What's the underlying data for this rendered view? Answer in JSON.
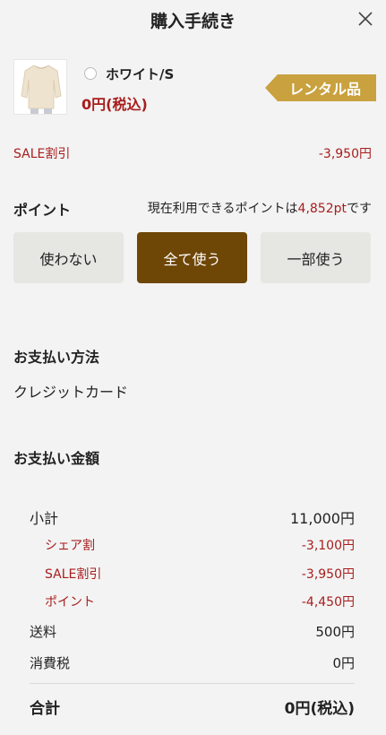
{
  "header": {
    "title": "購入手続き"
  },
  "product": {
    "variant": "ホワイト/S",
    "price": "0円(税込)",
    "badge": "レンタル品"
  },
  "sale": {
    "label": "SALE割引",
    "amount": "-3,950円"
  },
  "points": {
    "title": "ポイント",
    "info_prefix": "現在利用できるポイントは",
    "available": "4,852pt",
    "info_suffix": "です",
    "options": [
      "使わない",
      "全て使う",
      "一部使う"
    ],
    "selected": "全て使う"
  },
  "payment": {
    "title": "お支払い方法",
    "method": "クレジットカード"
  },
  "amount": {
    "title": "お支払い金額",
    "subtotal": {
      "label": "小計",
      "value": "11,000円"
    },
    "share_discount": {
      "label": "シェア割",
      "value": "-3,100円"
    },
    "sale_discount": {
      "label": "SALE割引",
      "value": "-3,950円"
    },
    "point_discount": {
      "label": "ポイント",
      "value": "-4,450円"
    },
    "shipping": {
      "label": "送料",
      "value": "500円"
    },
    "tax": {
      "label": "消費税",
      "value": "0円"
    },
    "total": {
      "label": "合計",
      "value": "0円(税込)"
    }
  },
  "colors": {
    "accent_red": "#a81d1d",
    "selected_button": "#6e4606",
    "badge_gold": "#c9a13e",
    "background": "#f3f3f3"
  }
}
